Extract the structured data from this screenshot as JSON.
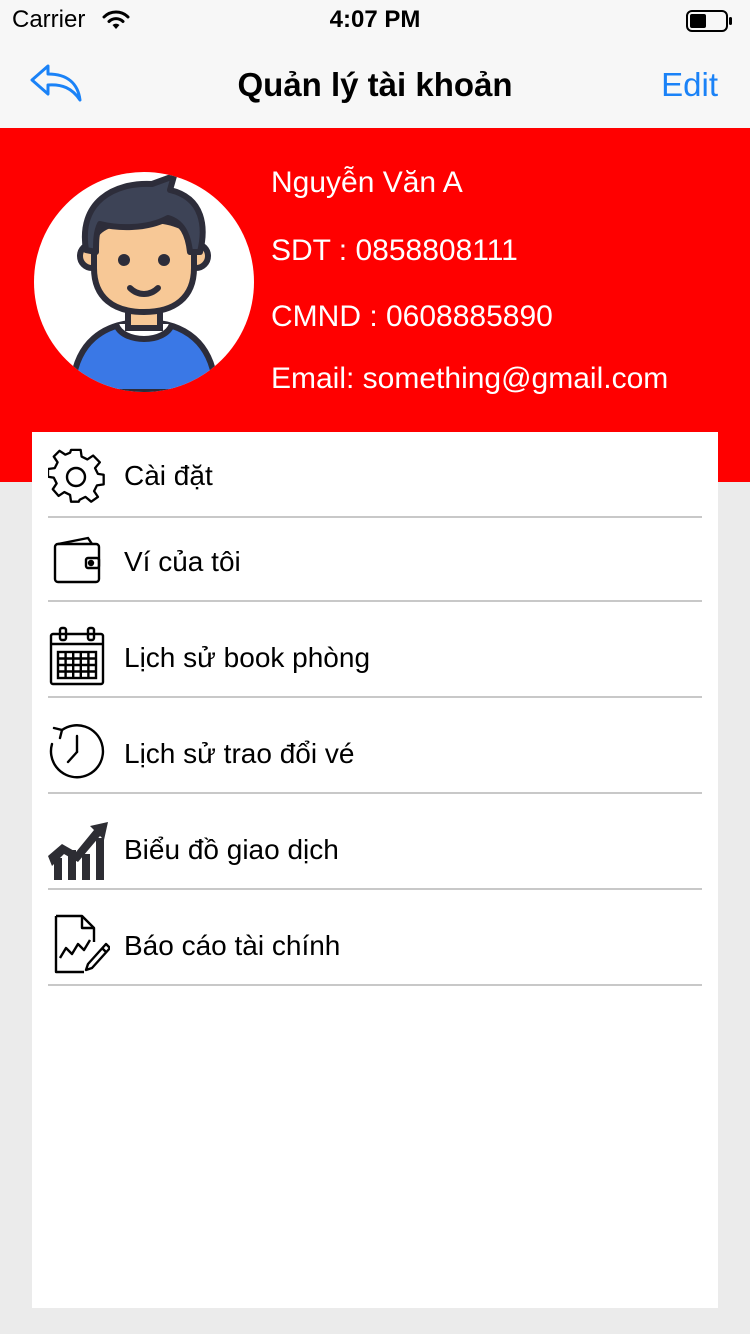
{
  "status_bar": {
    "carrier": "Carrier",
    "time": "4:07 PM"
  },
  "nav": {
    "title": "Quản lý tài khoản",
    "edit_label": "Edit",
    "back_icon": "reply-arrow-icon"
  },
  "colors": {
    "header_bg": "#ff0000",
    "accent": "#1a82f7",
    "page_bg": "#ebebeb"
  },
  "profile": {
    "name": "Nguyễn Văn A",
    "phone": "SDT : 0858808111",
    "id_card": "CMND : 0608885890",
    "email": "Email: something@gmail.com"
  },
  "menu": [
    {
      "label": "Cài đặt",
      "icon": "gear-icon"
    },
    {
      "label": "Ví của tôi",
      "icon": "wallet-icon"
    },
    {
      "label": "Lịch sử book phòng",
      "icon": "calendar-icon"
    },
    {
      "label": "Lịch sử trao đổi vé",
      "icon": "history-clock-icon"
    },
    {
      "label": "Biểu đồ giao dịch",
      "icon": "chart-icon"
    },
    {
      "label": "Báo cáo tài chính",
      "icon": "report-icon"
    }
  ]
}
